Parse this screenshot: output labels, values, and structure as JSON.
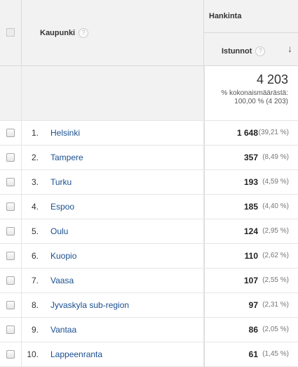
{
  "header": {
    "dimension_label": "Kaupunki",
    "help_glyph": "?",
    "group_label": "Hankinta",
    "metric_label": "Istunnot",
    "sort_glyph": "↓"
  },
  "summary": {
    "total": "4 203",
    "pct_label": "% kokonaismäärästä:",
    "pct_value": "100,00 % (4 203)"
  },
  "rows": [
    {
      "index": "1.",
      "city": "Helsinki",
      "value": "1 648",
      "pct": "(39,21 %)"
    },
    {
      "index": "2.",
      "city": "Tampere",
      "value": "357",
      "pct": "(8,49 %)"
    },
    {
      "index": "3.",
      "city": "Turku",
      "value": "193",
      "pct": "(4,59 %)"
    },
    {
      "index": "4.",
      "city": "Espoo",
      "value": "185",
      "pct": "(4,40 %)"
    },
    {
      "index": "5.",
      "city": "Oulu",
      "value": "124",
      "pct": "(2,95 %)"
    },
    {
      "index": "6.",
      "city": "Kuopio",
      "value": "110",
      "pct": "(2,62 %)"
    },
    {
      "index": "7.",
      "city": "Vaasa",
      "value": "107",
      "pct": "(2,55 %)"
    },
    {
      "index": "8.",
      "city": "Jyvaskyla sub-region",
      "value": "97",
      "pct": "(2,31 %)"
    },
    {
      "index": "9.",
      "city": "Vantaa",
      "value": "86",
      "pct": "(2,05 %)"
    },
    {
      "index": "10.",
      "city": "Lappeenranta",
      "value": "61",
      "pct": "(1,45 %)"
    }
  ]
}
